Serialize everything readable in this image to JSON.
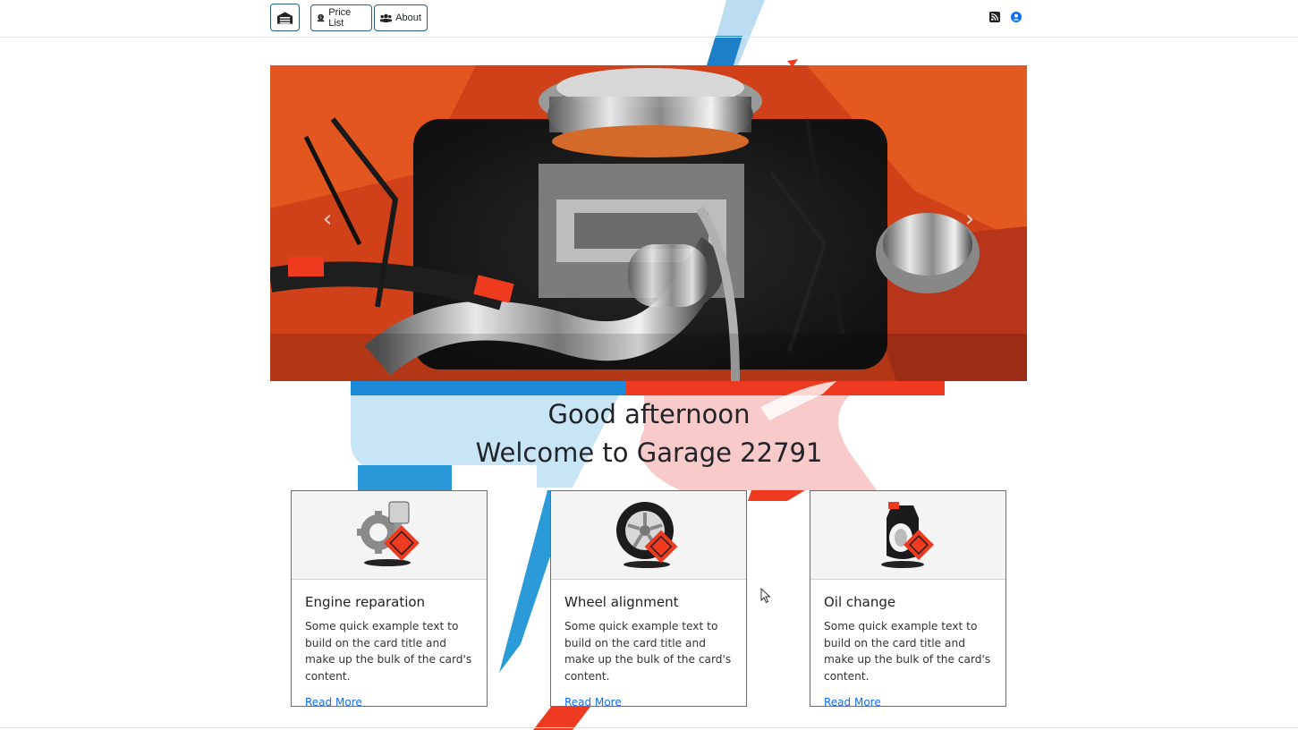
{
  "navbar": {
    "brand_icon": "garage-icon",
    "price_list_label": "Price List",
    "about_label": "About",
    "rss_icon": "rss-icon",
    "user_icon": "user-circle-icon"
  },
  "carousel": {
    "image": "engine-bay-photo",
    "prev_icon": "chevron-left-icon",
    "next_icon": "chevron-right-icon"
  },
  "greeting": {
    "line1": "Good afternoon",
    "line2": "Welcome to Garage 22791"
  },
  "cards": [
    {
      "icon": "engine-piston-gear-icon",
      "title": "Engine reparation",
      "text": "Some quick example text to build on the card title and make up the bulk of the card's content.",
      "link": "Read More"
    },
    {
      "icon": "wheel-icon",
      "title": "Wheel alignment",
      "text": "Some quick example text to build on the card title and make up the bulk of the card's content.",
      "link": "Read More"
    },
    {
      "icon": "oil-can-icon",
      "title": "Oil change",
      "text": "Some quick example text to build on the card title and make up the bulk of the card's content.",
      "link": "Read More"
    }
  ],
  "colors": {
    "accent_blue": "#1c8ad6",
    "accent_red": "#ee3a1e",
    "link": "#0d6efd",
    "nav_border": "#2a5f88"
  }
}
